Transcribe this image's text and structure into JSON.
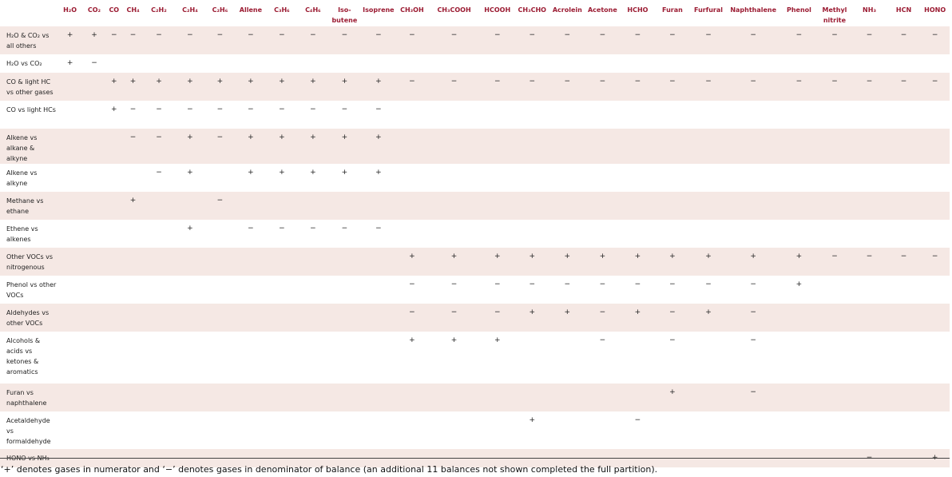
{
  "columns": [
    "H₂O",
    "CO₂",
    "CO",
    "CH₄",
    "C₂H₂",
    "C₂H₄",
    "C₂H₆",
    "Allene",
    "C₃H₆",
    "C₄H₆",
    "Iso-butene",
    "Isoprene",
    "CH₃OH",
    "CH₃COOH",
    "HCOOH",
    "CH₃CHO",
    "Acrolein",
    "Acetone",
    "HCHO",
    "Furan",
    "Furfural",
    "Naphthalene",
    "Phenol",
    "Methyl nitrite",
    "NH₃",
    "HCN",
    "HONO"
  ],
  "rows": [
    {
      "label": "H₂O & CO₂ vs all others",
      "cells": [
        "+",
        "+",
        "−",
        "−",
        "−",
        "−",
        "−",
        "−",
        "−",
        "−",
        "−",
        "−",
        "−",
        "−",
        "−",
        "−",
        "−",
        "−",
        "−",
        "−",
        "−",
        "−",
        "−",
        "−",
        "−",
        "−",
        "−"
      ]
    },
    {
      "label": "H₂O vs CO₂",
      "cells": [
        "+",
        "−",
        "",
        "",
        "",
        "",
        "",
        "",
        "",
        "",
        "",
        "",
        "",
        "",
        "",
        "",
        "",
        "",
        "",
        "",
        "",
        "",
        "",
        "",
        "",
        "",
        ""
      ]
    },
    {
      "label": "CO & light HC vs other gases",
      "cells": [
        "",
        "",
        "+",
        "+",
        "+",
        "+",
        "+",
        "+",
        "+",
        "+",
        "+",
        "+",
        "−",
        "−",
        "−",
        "−",
        "−",
        "−",
        "−",
        "−",
        "−",
        "−",
        "−",
        "−",
        "−",
        "−",
        "−"
      ]
    },
    {
      "label": "CO vs light HCs",
      "cells": [
        "",
        "",
        "+",
        "−",
        "−",
        "−",
        "−",
        "−",
        "−",
        "−",
        "−",
        "−",
        "",
        "",
        "",
        "",
        "",
        "",
        "",
        "",
        "",
        "",
        "",
        "",
        "",
        "",
        ""
      ]
    },
    {
      "label": "Alkene vs alkane & alkyne",
      "cells": [
        "",
        "",
        "",
        "−",
        "−",
        "+",
        "−",
        "+",
        "+",
        "+",
        "+",
        "+",
        "",
        "",
        "",
        "",
        "",
        "",
        "",
        "",
        "",
        "",
        "",
        "",
        "",
        "",
        ""
      ]
    },
    {
      "label": "Alkene vs alkyne",
      "cells": [
        "",
        "",
        "",
        "",
        "−",
        "+",
        "",
        "+",
        "+",
        "+",
        "+",
        "+",
        "",
        "",
        "",
        "",
        "",
        "",
        "",
        "",
        "",
        "",
        "",
        "",
        "",
        "",
        ""
      ]
    },
    {
      "label": "Methane vs ethane",
      "cells": [
        "",
        "",
        "",
        "+",
        "",
        "",
        "−",
        "",
        "",
        "",
        "",
        "",
        "",
        "",
        "",
        "",
        "",
        "",
        "",
        "",
        "",
        "",
        "",
        "",
        "",
        "",
        ""
      ]
    },
    {
      "label": "Ethene vs alkenes",
      "cells": [
        "",
        "",
        "",
        "",
        "",
        "+",
        "",
        "−",
        "−",
        "−",
        "−",
        "−",
        "",
        "",
        "",
        "",
        "",
        "",
        "",
        "",
        "",
        "",
        "",
        "",
        "",
        "",
        ""
      ]
    },
    {
      "label": "Other VOCs vs nitrogenous",
      "cells": [
        "",
        "",
        "",
        "",
        "",
        "",
        "",
        "",
        "",
        "",
        "",
        "",
        "+",
        "+",
        "+",
        "+",
        "+",
        "+",
        "+",
        "+",
        "+",
        "+",
        "+",
        "−",
        "−",
        "−",
        "−"
      ]
    },
    {
      "label": "Phenol vs other VOCs",
      "cells": [
        "",
        "",
        "",
        "",
        "",
        "",
        "",
        "",
        "",
        "",
        "",
        "",
        "−",
        "−",
        "−",
        "−",
        "−",
        "−",
        "−",
        "−",
        "−",
        "−",
        "+",
        "",
        "",
        "",
        ""
      ]
    },
    {
      "label": "Aldehydes vs other VOCs",
      "cells": [
        "",
        "",
        "",
        "",
        "",
        "",
        "",
        "",
        "",
        "",
        "",
        "",
        "−",
        "−",
        "−",
        "+",
        "+",
        "−",
        "+",
        "−",
        "+",
        "−",
        "",
        "",
        "",
        "",
        ""
      ]
    },
    {
      "label": "Alcohols & acids vs ketones & aromatics",
      "cells": [
        "",
        "",
        "",
        "",
        "",
        "",
        "",
        "",
        "",
        "",
        "",
        "",
        "+",
        "+",
        "+",
        "",
        "",
        "−",
        "",
        "−",
        "",
        "−",
        "",
        "",
        "",
        "",
        ""
      ]
    },
    {
      "label": "Furan vs naphthalene",
      "cells": [
        "",
        "",
        "",
        "",
        "",
        "",
        "",
        "",
        "",
        "",
        "",
        "",
        "",
        "",
        "",
        "",
        "",
        "",
        "",
        "+",
        "",
        "−",
        "",
        "",
        "",
        "",
        ""
      ]
    },
    {
      "label": "Acetaldehyde vs formaldehyde",
      "cells": [
        "",
        "",
        "",
        "",
        "",
        "",
        "",
        "",
        "",
        "",
        "",
        "",
        "",
        "",
        "",
        "+",
        "",
        "",
        "−",
        "",
        "",
        "",
        "",
        "",
        "",
        "",
        ""
      ]
    },
    {
      "label": "HONO vs NH₃",
      "cells": [
        "",
        "",
        "",
        "",
        "",
        "",
        "",
        "",
        "",
        "",
        "",
        "",
        "",
        "",
        "",
        "",
        "",
        "",
        "",
        "",
        "",
        "",
        "",
        "",
        "−",
        "",
        "+"
      ]
    }
  ],
  "footnote": "‘+’ denotes gases in numerator and ‘−’ denotes gases in denominator of balance (an additional 11 balances not shown completed the full partition).",
  "colors": {
    "header_text": "#9b1b32",
    "shaded_row": "#f5e8e4"
  }
}
